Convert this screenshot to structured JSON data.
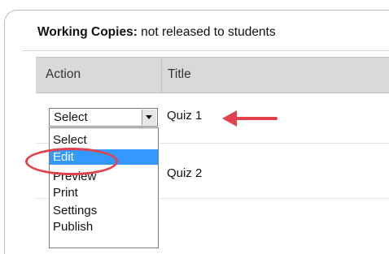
{
  "tab": {
    "bold": "Working Copies:",
    "rest": " not released to students"
  },
  "table": {
    "headers": {
      "action": "Action",
      "title": "Title"
    },
    "rows": [
      {
        "title": "Quiz 1"
      },
      {
        "title": "Quiz 2"
      }
    ]
  },
  "select": {
    "value": "Select",
    "options": [
      "Select",
      "Edit",
      "Preview",
      "Print",
      "Settings",
      "Publish"
    ],
    "highlighted": "Edit"
  },
  "colors": {
    "accent_highlight": "#3399ff",
    "annotation_red": "#e0414b"
  }
}
